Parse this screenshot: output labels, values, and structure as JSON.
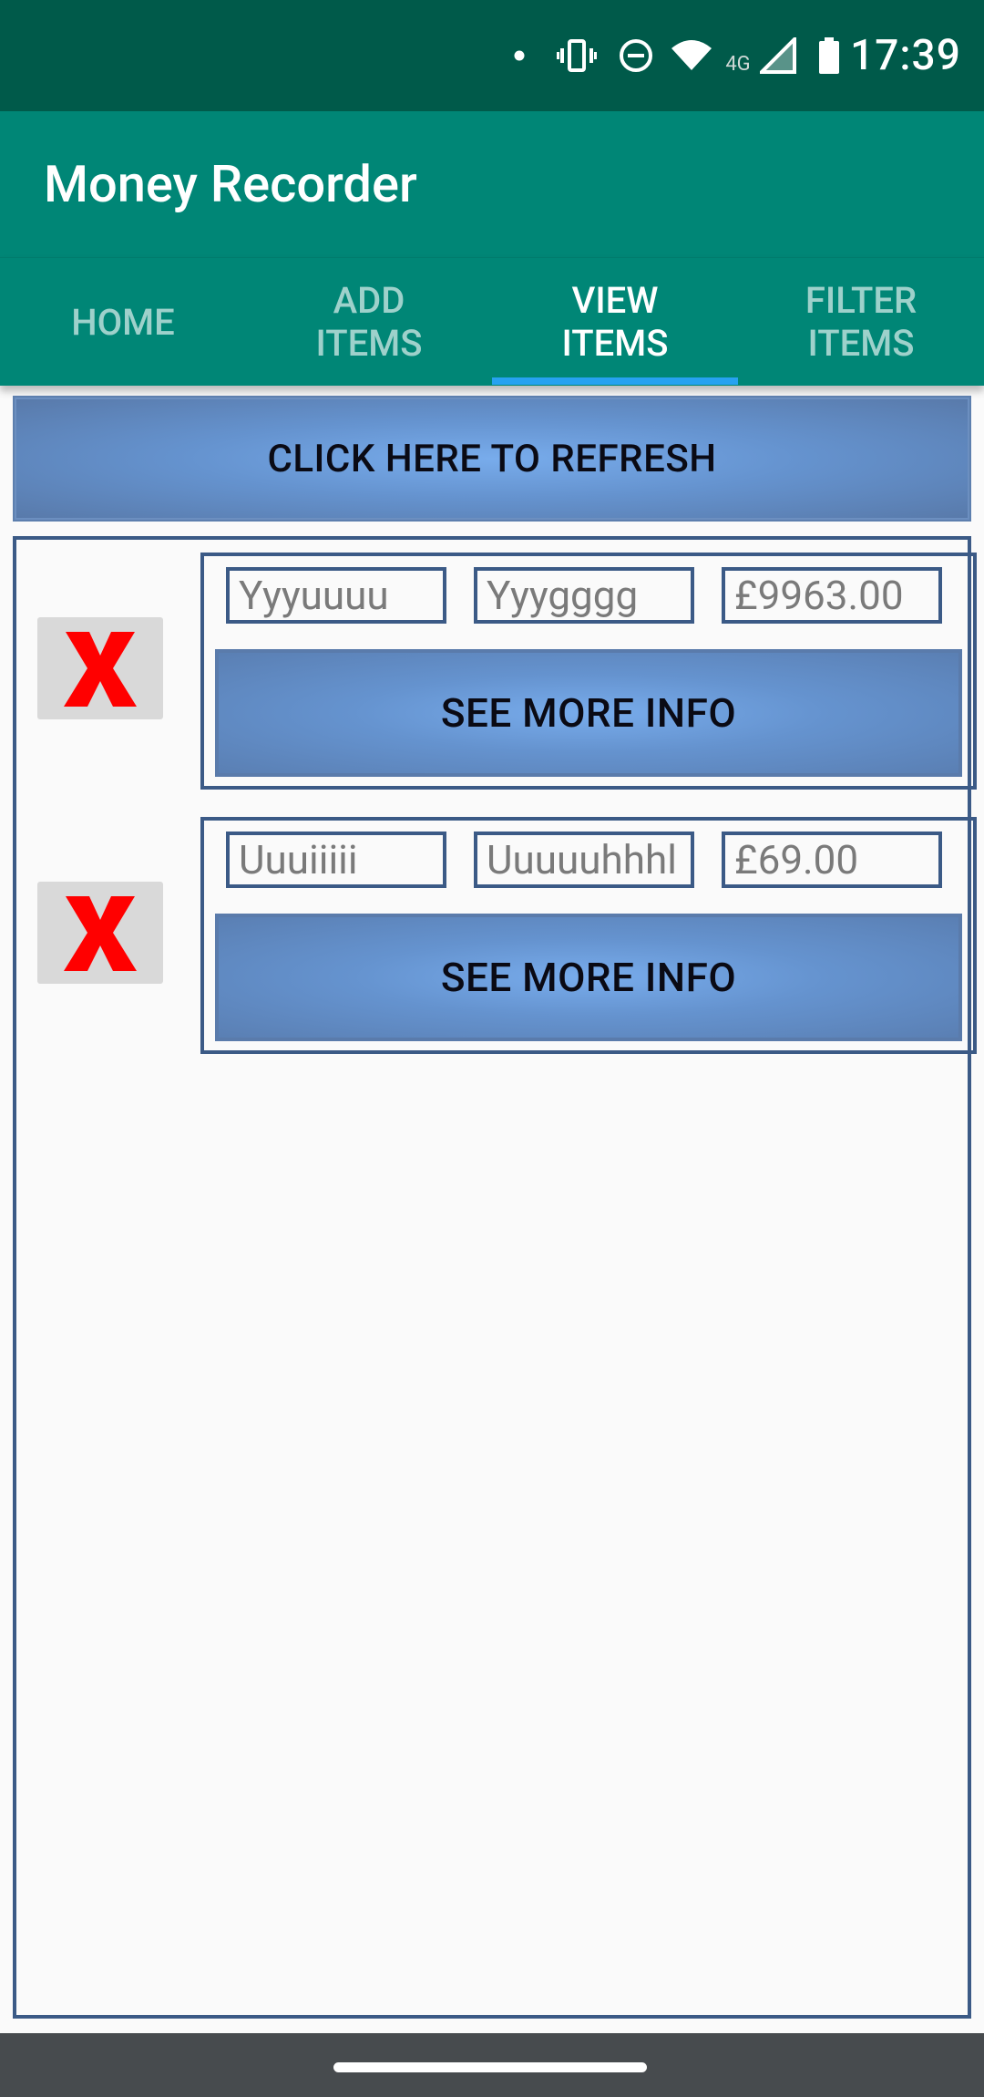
{
  "status_bar": {
    "time": "17:39",
    "network_label": "4G",
    "icons": [
      "notification-dot-icon",
      "vibrate-icon",
      "do-not-disturb-icon",
      "wifi-icon",
      "signal-icon",
      "battery-icon"
    ]
  },
  "app_bar": {
    "title": "Money Recorder"
  },
  "tabs": [
    {
      "label": "HOME",
      "active": false
    },
    {
      "label": "ADD\nITEMS",
      "active": false
    },
    {
      "label": "VIEW\nITEMS",
      "active": true
    },
    {
      "label": "FILTER\nITEMS",
      "active": false
    }
  ],
  "refresh_button": {
    "label": "CLICK HERE TO REFRESH"
  },
  "items": [
    {
      "field1": "Yyyuuuu",
      "field2": "Yyygggg",
      "amount": "£9963.00",
      "info_label": "SEE MORE INFO",
      "delete_icon": "red-x-icon"
    },
    {
      "field1": "Uuuiiiii",
      "field2": "Uuuuuhhhl",
      "amount": "£69.00",
      "info_label": "SEE MORE INFO",
      "delete_icon": "red-x-icon"
    }
  ],
  "colors": {
    "status_bar": "#005a4a",
    "app_bar": "#008676",
    "tab_indicator": "#27a2f0",
    "button_blue": "#6593cf",
    "border_blue": "#3b5a86",
    "delete_red": "#ff0000"
  }
}
